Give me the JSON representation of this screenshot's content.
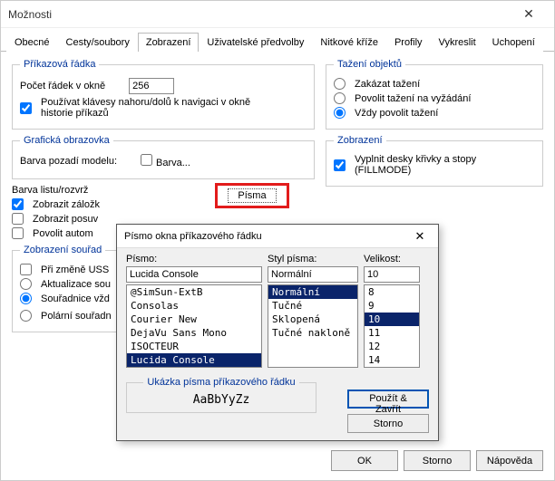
{
  "window": {
    "title": "Možnosti"
  },
  "tabs": [
    "Obecné",
    "Cesty/soubory",
    "Zobrazení",
    "Uživatelské předvolby",
    "Nitkové kříže",
    "Profily",
    "Vykreslit",
    "Uchopení"
  ],
  "activeTab": 2,
  "cmdline": {
    "legend": "Příkazová řádka",
    "rowsLabel": "Počet řádek v okně",
    "rowsValue": "256",
    "useKeys": "Používat klávesy nahoru/dolů k navigaci v okně historie příkazů"
  },
  "graphics": {
    "legend": "Grafická obrazovka",
    "bgLabel": "Barva pozadí modelu:",
    "colorBtn": "Barva...",
    "fontsBtn": "Písma"
  },
  "sheetColor": "Barva listu/rozvrž",
  "chk": {
    "tabs": "Zobrazit záložk",
    "scroll": "Zobrazit posuv",
    "auto": "Povolit autom"
  },
  "coordDisp": {
    "legend": "Zobrazení souřad",
    "ucs": "Při změně USS",
    "update": "Aktualizace sou",
    "always": "Souřadnice vžd",
    "polar": "Polární souřadn"
  },
  "drag": {
    "legend": "Tažení objektů",
    "none": "Zakázat tažení",
    "demand": "Povolit tažení na vyžádání",
    "always": "Vždy povolit tažení"
  },
  "view": {
    "legend": "Zobrazení",
    "fill": "Vyplnit desky křivky a stopy (FILLMODE)"
  },
  "fontDialog": {
    "title": "Písmo okna příkazového řádku",
    "fontLabel": "Písmo:",
    "styleLabel": "Styl písma:",
    "sizeLabel": "Velikost:",
    "fontValue": "Lucida Console",
    "styleValue": "Normální",
    "sizeValue": "10",
    "fonts": [
      "@SimSun-ExtB",
      "Consolas",
      "Courier New",
      "DejaVu Sans Mono",
      "ISOCTEUR",
      "Lucida Console"
    ],
    "fontSel": 5,
    "styles": [
      "Normální",
      "Tučné",
      "Sklopená",
      "Tučné nakloně"
    ],
    "styleSel": 0,
    "sizes": [
      "8",
      "9",
      "10",
      "11",
      "12",
      "14"
    ],
    "sizeSel": 2,
    "sampleLegend": "Ukázka písma příkazového řádku",
    "sample": "AaBbYyZz",
    "apply": "Použít & Zavřít",
    "cancel": "Storno"
  },
  "buttons": {
    "ok": "OK",
    "cancel": "Storno",
    "help": "Nápověda"
  }
}
